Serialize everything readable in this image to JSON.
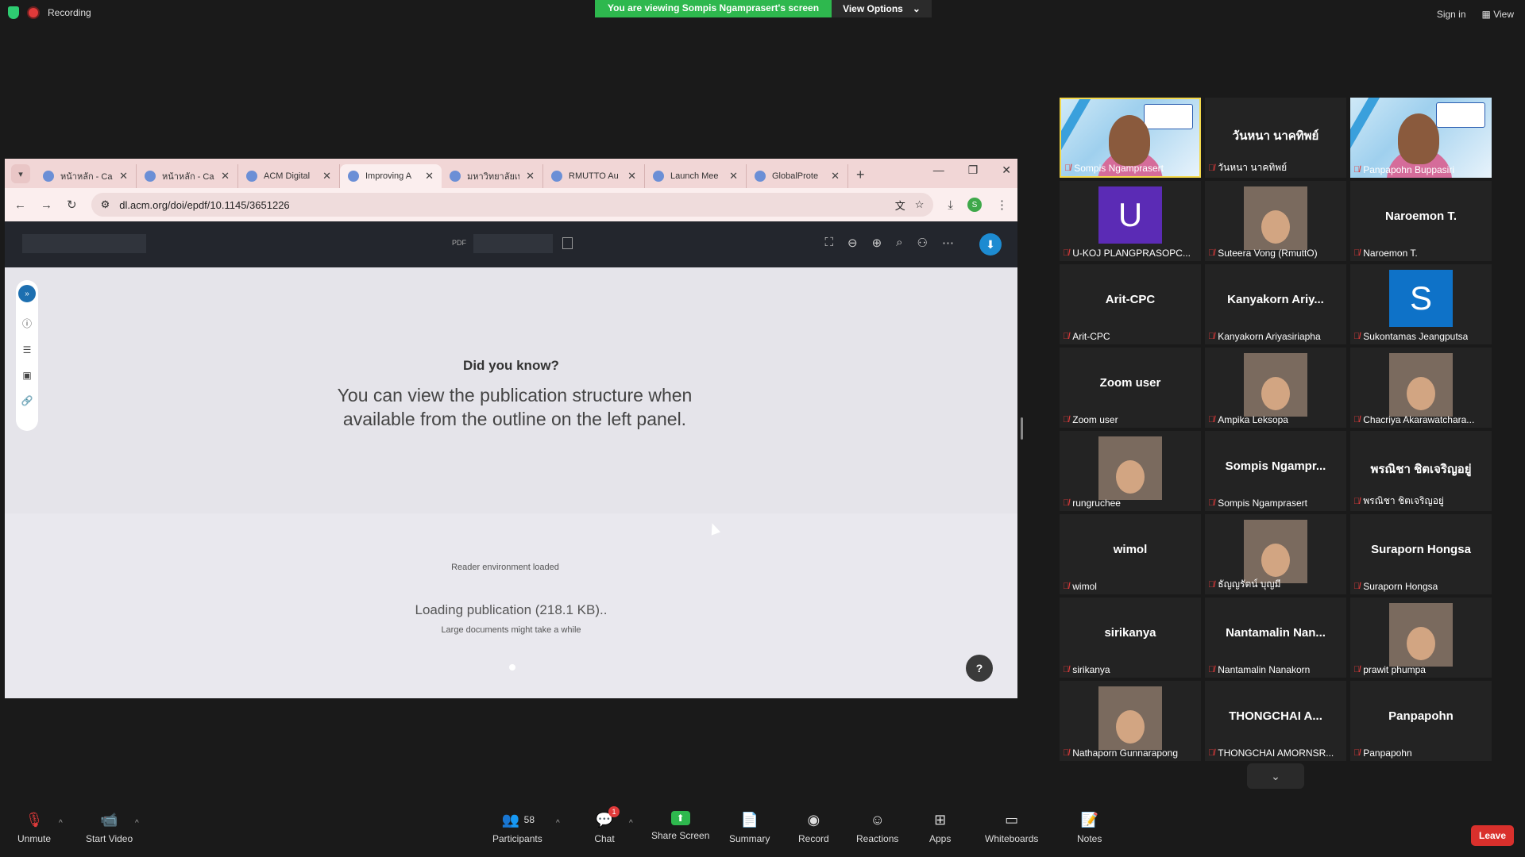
{
  "zoom": {
    "recording_label": "Recording",
    "share_banner": "You are viewing Sompis Ngamprasert's screen",
    "view_options": "View Options",
    "sign_in": "Sign in",
    "view": "View"
  },
  "browser": {
    "tabs": [
      {
        "title": "หน้าหลัก - Ca"
      },
      {
        "title": "หน้าหลัก - Ca"
      },
      {
        "title": "ACM Digital"
      },
      {
        "title": "Improving A"
      },
      {
        "title": "มหาวิทยาลัยเท"
      },
      {
        "title": "RMUTTO Au"
      },
      {
        "title": "Launch Mee"
      },
      {
        "title": "GlobalProte"
      }
    ],
    "url": "dl.acm.org/doi/epdf/10.1145/3651226",
    "profile_letter": "S"
  },
  "pdf": {
    "pdf_label": "PDF",
    "dyk_title": "Did you know?",
    "dyk_text": "You can view the publication structure when available from the outline on the left panel.",
    "env_loaded": "Reader environment loaded",
    "loading": "Loading publication (218.1 KB)..",
    "large_docs": "Large documents might take a while",
    "help": "?"
  },
  "participants": [
    {
      "name": "Sompis Ngamprasert",
      "big": "",
      "type": "camera",
      "highlight": true
    },
    {
      "name": "วันหนา นาคทิพย์",
      "big": "วันหนา นาคทิพย์",
      "type": "name"
    },
    {
      "name": "Panpapohn Buppasiri",
      "big": "",
      "type": "camera"
    },
    {
      "name": "U-KOJ PLANGPRASOPC...",
      "big": "",
      "type": "avatar",
      "letter": "U",
      "color": "#5b2bb5"
    },
    {
      "name": "Suteera Vong (RmuttO)",
      "big": "",
      "type": "photo"
    },
    {
      "name": "Naroemon T.",
      "big": "Naroemon T.",
      "type": "name"
    },
    {
      "name": "Arit-CPC",
      "big": "Arit-CPC",
      "type": "name"
    },
    {
      "name": "Kanyakorn Ariyasiriapha",
      "big": "Kanyakorn  Ariy...",
      "type": "name"
    },
    {
      "name": "Sukontamas Jeangputsa",
      "big": "",
      "type": "avatar",
      "letter": "S",
      "color": "#0e72c8"
    },
    {
      "name": "Zoom user",
      "big": "Zoom user",
      "type": "name"
    },
    {
      "name": "Ampika Leksopa",
      "big": "",
      "type": "photo"
    },
    {
      "name": "Chacriya Akarawatchara...",
      "big": "",
      "type": "photo"
    },
    {
      "name": "rungruchee",
      "big": "",
      "type": "photo"
    },
    {
      "name": "Sompis Ngamprasert",
      "big": "Sompis  Ngampr...",
      "type": "name"
    },
    {
      "name": "พรณิชา ชิตเจริญอยู่",
      "big": "พรณิชา ชิตเจริญอยู่",
      "type": "name"
    },
    {
      "name": "wimol",
      "big": "wimol",
      "type": "name"
    },
    {
      "name": "ธัญญรัตน์ บุญมี",
      "big": "",
      "type": "photo"
    },
    {
      "name": "Suraporn Hongsa",
      "big": "Suraporn Hongsa",
      "type": "name"
    },
    {
      "name": "sirikanya",
      "big": "sirikanya",
      "type": "name"
    },
    {
      "name": "Nantamalin Nanakorn",
      "big": "Nantamalin  Nan...",
      "type": "name"
    },
    {
      "name": "prawit phumpa",
      "big": "",
      "type": "photo"
    },
    {
      "name": "Nathaporn Gunnarapong",
      "big": "",
      "type": "photo"
    },
    {
      "name": "THONGCHAI AMORNSR...",
      "big": "THONGCHAI  A...",
      "type": "name"
    },
    {
      "name": "Panpapohn",
      "big": "Panpapohn",
      "type": "name"
    }
  ],
  "toolbar": {
    "unmute": "Unmute",
    "start_video": "Start Video",
    "participants": "Participants",
    "participant_count": "58",
    "chat": "Chat",
    "chat_badge": "1",
    "share_screen": "Share Screen",
    "summary": "Summary",
    "record": "Record",
    "reactions": "Reactions",
    "apps": "Apps",
    "whiteboards": "Whiteboards",
    "notes": "Notes",
    "leave": "Leave"
  }
}
